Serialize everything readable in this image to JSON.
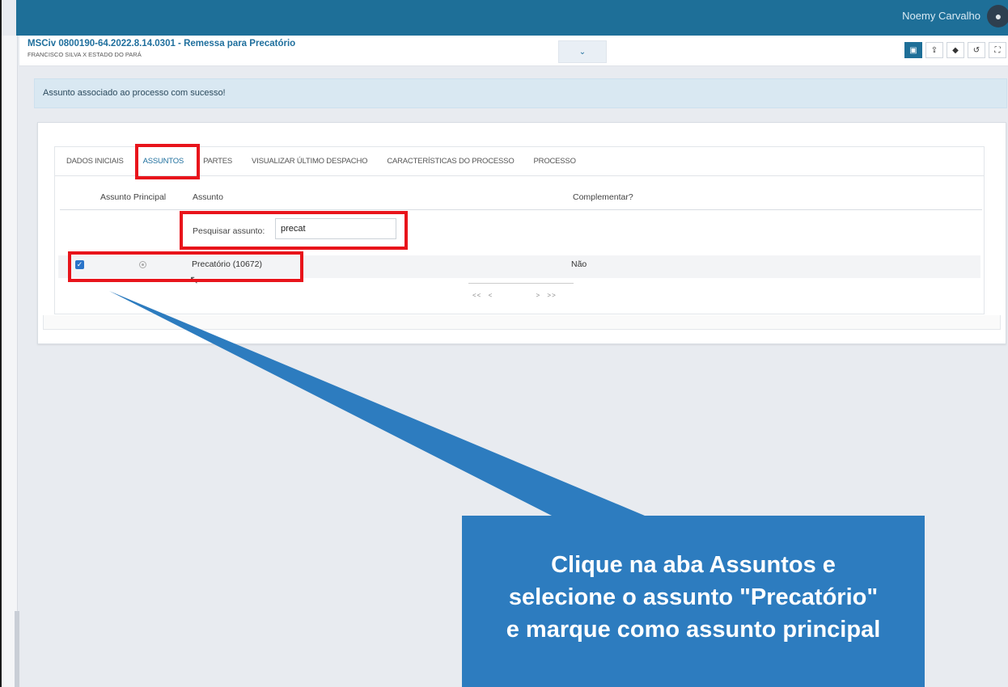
{
  "user": {
    "name": "Noemy Carvalho",
    "avatar_glyph": "●"
  },
  "process": {
    "title": "MSCiv 0800190-64.2022.8.14.0301 - Remessa para Precatório",
    "parties": "FRANCISCO SILVA X ESTADO DO PARÁ",
    "toggle_icon": "⌄"
  },
  "toolbar": [
    {
      "icon": "▣",
      "name": "save-icon"
    },
    {
      "icon": "⇪",
      "name": "share-icon"
    },
    {
      "icon": "◆",
      "name": "tag-icon"
    },
    {
      "icon": "↺",
      "name": "history-icon"
    },
    {
      "icon": "⛶",
      "name": "fullscreen-icon"
    }
  ],
  "alert": {
    "message": "Assunto associado ao processo com sucesso!"
  },
  "tabs": [
    {
      "label": "DADOS INICIAIS",
      "active": false
    },
    {
      "label": "ASSUNTOS",
      "active": true
    },
    {
      "label": "PARTES",
      "active": false
    },
    {
      "label": "VISUALIZAR ÚLTIMO DESPACHO",
      "active": false
    },
    {
      "label": "CARACTERÍSTICAS DO PROCESSO",
      "active": false
    },
    {
      "label": "PROCESSO",
      "active": false
    }
  ],
  "table": {
    "headers": {
      "principal": "Assunto Principal",
      "assunto": "Assunto",
      "complementar": "Complementar?"
    },
    "search": {
      "label": "Pesquisar assunto:",
      "value": "precat"
    },
    "rows": [
      {
        "checked": true,
        "subject": "Precatório (10672)",
        "complementar": "Não"
      }
    ],
    "pager": {
      "first": "<<",
      "prev": "<",
      "next": ">",
      "last": ">>"
    }
  },
  "callout": {
    "lines": [
      "Clique na aba Assuntos e",
      "selecione o assunto \"Precatório\"",
      "e marque como assunto principal"
    ],
    "color": "#2d7cbf"
  },
  "colors": {
    "highlight": "#e8141b",
    "topbar": "#1e6f98",
    "accent": "#1f6f9d"
  }
}
